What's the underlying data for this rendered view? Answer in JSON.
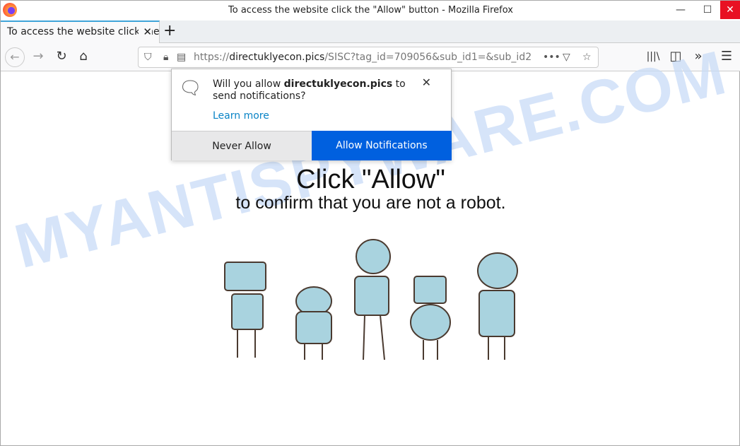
{
  "window": {
    "title": "To access the website click the \"Allow\" button - Mozilla Firefox",
    "minimize": "—",
    "maximize": "☐",
    "close": "✕"
  },
  "tab": {
    "label": "To access the website click the \"Allow\" button",
    "close": "✕",
    "new": "+"
  },
  "nav": {
    "back": "←",
    "forward": "→",
    "reload": "↻",
    "home": "⌂",
    "url_scheme": "https://",
    "url_host": "directuklyecon.pics",
    "url_path": "/SISC?tag_id=709056&sub_id1=&sub_id2",
    "more": "•••",
    "library": "|||\\",
    "sidebar": "◫",
    "overflow": "»",
    "menu": "☰"
  },
  "popup": {
    "msg_pre": "Will you allow ",
    "msg_host": "directuklyecon.pics",
    "msg_post": " to send notifications?",
    "learn_more": "Learn more",
    "close": "✕",
    "never": "Never Allow",
    "allow": "Allow Notifications"
  },
  "page": {
    "headline": "Click \"Allow\"",
    "subline": "to confirm that you are not a robot.",
    "watermark": "MYANTISPYWARE.COM"
  },
  "colors": {
    "allow_button": "#0060df",
    "close_button": "#e81123",
    "tab_accent": "#3fa4d9",
    "robot": "#a9d3df"
  }
}
